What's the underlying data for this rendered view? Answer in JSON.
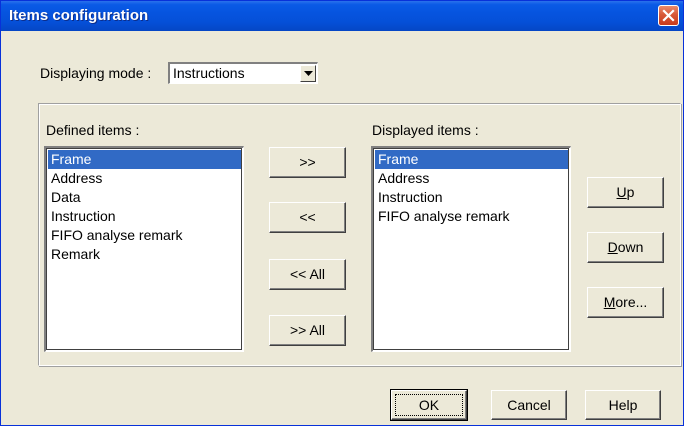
{
  "window": {
    "title": "Items configuration"
  },
  "display_mode": {
    "label": "Displaying mode :",
    "value": "Instructions"
  },
  "defined": {
    "label": "Defined items :",
    "items": [
      "Frame",
      "Address",
      "Data",
      "Instruction",
      "FIFO analyse remark",
      "Remark"
    ],
    "selected_index": 0
  },
  "displayed": {
    "label": "Displayed items :",
    "items": [
      "Frame",
      "Address",
      "Instruction",
      "FIFO analyse remark"
    ],
    "selected_index": 0
  },
  "transfer_buttons": {
    "add": ">>",
    "remove": "<<",
    "remove_all": "<< All",
    "add_all": ">> All"
  },
  "order_buttons": {
    "up_mnemonic": "U",
    "up_rest": "p",
    "down_mnemonic": "D",
    "down_rest": "own",
    "more_mnemonic": "M",
    "more_rest": "ore..."
  },
  "footer": {
    "ok": "OK",
    "cancel": "Cancel",
    "help": "Help"
  },
  "colors": {
    "title_bar": "#0654df",
    "selection": "#316ac5",
    "face": "#ece9d8",
    "close_button": "#d85a3a"
  },
  "icons": {
    "close": "close-icon",
    "combo_arrow": "chevron-down-icon"
  }
}
